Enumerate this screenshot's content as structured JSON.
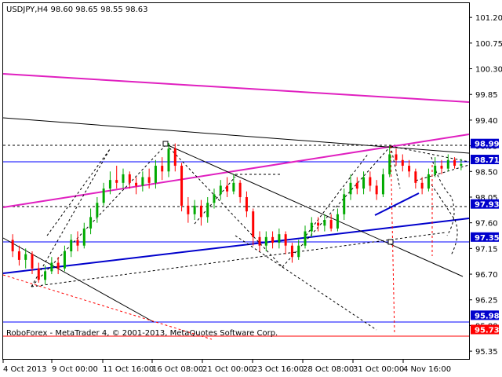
{
  "header": {
    "symbol_text": "USDJPY,H4  98.60 98.65 98.55 98.63"
  },
  "footer": {
    "copyright": "RoboForex - MetaTrader 4, © 2001-2013, MetaQuotes Software Corp."
  },
  "colors": {
    "candle_up": "#00aa00",
    "candle_down": "#ff0000",
    "trend_blue": "#0000cc",
    "channel_magenta": "#e020c0",
    "level_blue": "#0000ff",
    "level_red": "#ff0000",
    "dashed_black": "#000000",
    "badge_blue": "#0000cc",
    "badge_red": "#ff0000"
  },
  "price_badges": [
    {
      "label": "98.99",
      "price": 98.99,
      "color": "blue"
    },
    {
      "label": "98.71",
      "price": 98.71,
      "color": "blue"
    },
    {
      "label": "97.93",
      "price": 97.93,
      "color": "blue"
    },
    {
      "label": "97.35",
      "price": 97.35,
      "color": "blue"
    },
    {
      "label": "95.98",
      "price": 95.98,
      "color": "blue"
    },
    {
      "label": "95.73",
      "price": 95.73,
      "color": "red"
    }
  ],
  "chart_data": {
    "type": "candlestick",
    "y_ticks": [
      "101.20",
      "100.75",
      "100.30",
      "99.85",
      "99.40",
      "98.95",
      "98.50",
      "98.05",
      "97.60",
      "97.15",
      "96.70",
      "96.25",
      "95.80",
      "95.35"
    ],
    "y_tick_values": [
      101.2,
      100.75,
      100.3,
      99.85,
      99.4,
      98.95,
      98.5,
      98.05,
      97.6,
      97.15,
      96.7,
      96.25,
      95.8,
      95.35
    ],
    "x_ticks": [
      "4 Oct 2013",
      "9 Oct 00:00",
      "11 Oct 16:00",
      "16 Oct 08:00",
      "21 Oct 00:00",
      "23 Oct 16:00",
      "28 Oct 08:00",
      "31 Oct 00:00",
      "4 Nov 16:00"
    ],
    "ylim": [
      95.2,
      101.45
    ],
    "grid": false,
    "candles": [
      {
        "o": 97.3,
        "c": 97.1,
        "h": 97.4,
        "l": 97.0
      },
      {
        "o": 97.1,
        "c": 96.95,
        "h": 97.2,
        "l": 96.85
      },
      {
        "o": 96.95,
        "c": 97.05,
        "h": 97.15,
        "l": 96.8
      },
      {
        "o": 97.05,
        "c": 96.8,
        "h": 97.1,
        "l": 96.7
      },
      {
        "o": 96.8,
        "c": 96.6,
        "h": 96.9,
        "l": 96.55
      },
      {
        "o": 96.6,
        "c": 96.75,
        "h": 96.85,
        "l": 96.52
      },
      {
        "o": 96.75,
        "c": 96.9,
        "h": 97.0,
        "l": 96.7
      },
      {
        "o": 96.9,
        "c": 96.8,
        "h": 97.0,
        "l": 96.7
      },
      {
        "o": 96.8,
        "c": 97.1,
        "h": 97.2,
        "l": 96.75
      },
      {
        "o": 97.1,
        "c": 97.3,
        "h": 97.4,
        "l": 97.0
      },
      {
        "o": 97.3,
        "c": 97.2,
        "h": 97.45,
        "l": 97.1
      },
      {
        "o": 97.2,
        "c": 97.5,
        "h": 97.6,
        "l": 97.15
      },
      {
        "o": 97.5,
        "c": 97.7,
        "h": 97.85,
        "l": 97.4
      },
      {
        "o": 97.7,
        "c": 97.95,
        "h": 98.05,
        "l": 97.6
      },
      {
        "o": 97.95,
        "c": 98.2,
        "h": 98.3,
        "l": 97.9
      },
      {
        "o": 98.2,
        "c": 98.35,
        "h": 98.5,
        "l": 98.1
      },
      {
        "o": 98.35,
        "c": 98.3,
        "h": 98.6,
        "l": 98.2
      },
      {
        "o": 98.3,
        "c": 98.45,
        "h": 98.55,
        "l": 98.2
      },
      {
        "o": 98.45,
        "c": 98.3,
        "h": 98.5,
        "l": 98.2
      },
      {
        "o": 98.3,
        "c": 98.25,
        "h": 98.4,
        "l": 98.1
      },
      {
        "o": 98.25,
        "c": 98.4,
        "h": 98.5,
        "l": 98.15
      },
      {
        "o": 98.4,
        "c": 98.3,
        "h": 98.55,
        "l": 98.2
      },
      {
        "o": 98.3,
        "c": 98.6,
        "h": 98.7,
        "l": 98.2
      },
      {
        "o": 98.6,
        "c": 98.5,
        "h": 98.75,
        "l": 98.35
      },
      {
        "o": 98.5,
        "c": 98.9,
        "h": 99.0,
        "l": 98.4
      },
      {
        "o": 98.9,
        "c": 98.6,
        "h": 98.99,
        "l": 98.5
      },
      {
        "o": 98.6,
        "c": 97.9,
        "h": 98.65,
        "l": 97.8
      },
      {
        "o": 97.9,
        "c": 97.75,
        "h": 98.05,
        "l": 97.6
      },
      {
        "o": 97.75,
        "c": 97.9,
        "h": 98.0,
        "l": 97.65
      },
      {
        "o": 97.9,
        "c": 97.7,
        "h": 98.0,
        "l": 97.55
      },
      {
        "o": 97.7,
        "c": 97.95,
        "h": 98.05,
        "l": 97.6
      },
      {
        "o": 97.95,
        "c": 98.1,
        "h": 98.2,
        "l": 97.85
      },
      {
        "o": 98.1,
        "c": 98.25,
        "h": 98.35,
        "l": 98.0
      },
      {
        "o": 98.25,
        "c": 98.15,
        "h": 98.4,
        "l": 98.05
      },
      {
        "o": 98.15,
        "c": 98.3,
        "h": 98.45,
        "l": 98.1
      },
      {
        "o": 98.3,
        "c": 98.05,
        "h": 98.35,
        "l": 97.95
      },
      {
        "o": 98.05,
        "c": 97.8,
        "h": 98.15,
        "l": 97.7
      },
      {
        "o": 97.8,
        "c": 97.35,
        "h": 97.85,
        "l": 97.2
      },
      {
        "o": 97.35,
        "c": 97.2,
        "h": 97.45,
        "l": 97.1
      },
      {
        "o": 97.2,
        "c": 97.35,
        "h": 97.45,
        "l": 97.1
      },
      {
        "o": 97.35,
        "c": 97.25,
        "h": 97.45,
        "l": 97.15
      },
      {
        "o": 97.25,
        "c": 97.4,
        "h": 97.5,
        "l": 97.15
      },
      {
        "o": 97.4,
        "c": 97.2,
        "h": 97.45,
        "l": 97.05
      },
      {
        "o": 97.2,
        "c": 97.0,
        "h": 97.25,
        "l": 96.9
      },
      {
        "o": 97.0,
        "c": 97.2,
        "h": 97.3,
        "l": 96.95
      },
      {
        "o": 97.2,
        "c": 97.45,
        "h": 97.55,
        "l": 97.15
      },
      {
        "o": 97.45,
        "c": 97.6,
        "h": 97.7,
        "l": 97.35
      },
      {
        "o": 97.6,
        "c": 97.55,
        "h": 97.7,
        "l": 97.45
      },
      {
        "o": 97.55,
        "c": 97.65,
        "h": 97.75,
        "l": 97.45
      },
      {
        "o": 97.65,
        "c": 97.5,
        "h": 97.75,
        "l": 97.45
      },
      {
        "o": 97.5,
        "c": 97.75,
        "h": 97.85,
        "l": 97.45
      },
      {
        "o": 97.75,
        "c": 98.1,
        "h": 98.2,
        "l": 97.65
      },
      {
        "o": 98.1,
        "c": 98.3,
        "h": 98.45,
        "l": 98.0
      },
      {
        "o": 98.3,
        "c": 98.2,
        "h": 98.4,
        "l": 98.1
      },
      {
        "o": 98.2,
        "c": 98.4,
        "h": 98.5,
        "l": 98.1
      },
      {
        "o": 98.4,
        "c": 98.25,
        "h": 98.5,
        "l": 98.15
      },
      {
        "o": 98.25,
        "c": 98.1,
        "h": 98.35,
        "l": 98.0
      },
      {
        "o": 98.1,
        "c": 98.45,
        "h": 98.55,
        "l": 98.05
      },
      {
        "o": 98.45,
        "c": 98.8,
        "h": 98.95,
        "l": 98.4
      },
      {
        "o": 98.8,
        "c": 98.7,
        "h": 98.9,
        "l": 98.6
      },
      {
        "o": 98.7,
        "c": 98.6,
        "h": 98.8,
        "l": 98.5
      },
      {
        "o": 98.6,
        "c": 98.5,
        "h": 98.7,
        "l": 98.4
      },
      {
        "o": 98.5,
        "c": 98.3,
        "h": 98.55,
        "l": 98.2
      },
      {
        "o": 98.3,
        "c": 98.2,
        "h": 98.4,
        "l": 98.1
      },
      {
        "o": 98.2,
        "c": 98.45,
        "h": 98.55,
        "l": 98.15
      },
      {
        "o": 98.45,
        "c": 98.6,
        "h": 98.75,
        "l": 98.4
      },
      {
        "o": 98.6,
        "c": 98.55,
        "h": 98.7,
        "l": 98.45
      },
      {
        "o": 98.55,
        "c": 98.7,
        "h": 98.8,
        "l": 98.5
      },
      {
        "o": 98.7,
        "c": 98.6,
        "h": 98.75,
        "l": 98.55
      },
      {
        "o": 98.6,
        "c": 98.63,
        "h": 98.72,
        "l": 98.52
      }
    ]
  }
}
